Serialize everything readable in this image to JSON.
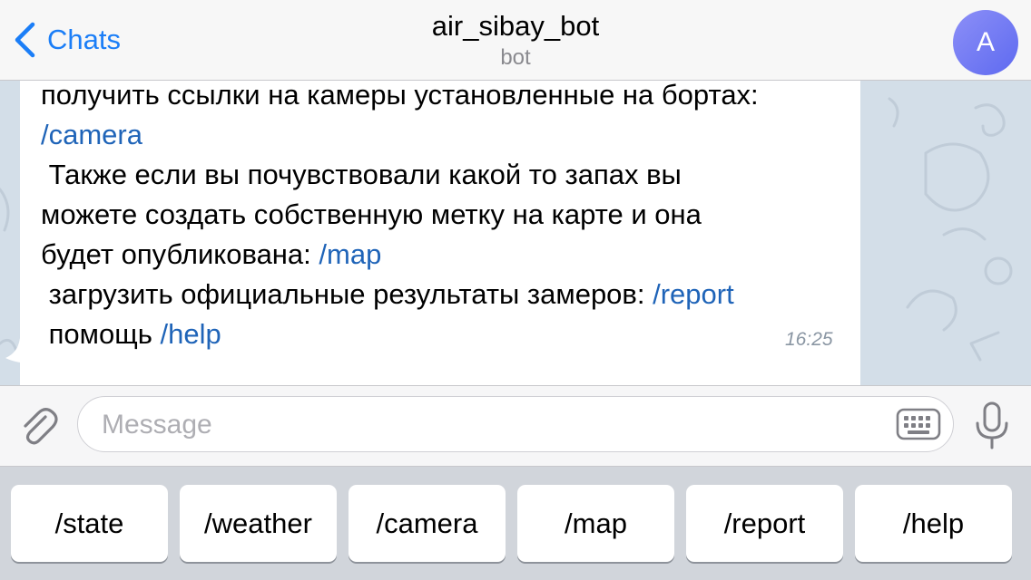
{
  "header": {
    "back_label": "Chats",
    "title": "air_sibay_bot",
    "subtitle": "bot",
    "avatar_letter": "A"
  },
  "message": {
    "lines": [
      {
        "text": "получить ссылки на камеры установленные на бортах:",
        "cmd": ""
      },
      {
        "text": "",
        "cmd": "/camera"
      },
      {
        "text": " Также если вы почувствовали какой то запах вы",
        "cmd": ""
      },
      {
        "text": "можете создать собственную метку на карте и она",
        "cmd": ""
      },
      {
        "text": "будет опубликована: ",
        "cmd": "/map"
      },
      {
        "text": " загрузить официальные результаты замеров: ",
        "cmd": "/report"
      },
      {
        "text": " помощь ",
        "cmd": "/help"
      }
    ],
    "time": "16:25"
  },
  "input": {
    "placeholder": "Message",
    "value": ""
  },
  "keyboard": {
    "buttons": [
      "/state",
      "/weather",
      "/camera",
      "/map",
      "/report",
      "/help"
    ]
  },
  "icons": {
    "back": "chevron-left-icon",
    "attach": "paperclip-icon",
    "keyboard": "keyboard-icon",
    "mic": "microphone-icon"
  },
  "colors": {
    "accent": "#1b7ef7",
    "link": "#1f64b8",
    "chat_background": "#d3dee8",
    "avatar_from": "#8c8ff7",
    "avatar_to": "#5e6af0"
  }
}
